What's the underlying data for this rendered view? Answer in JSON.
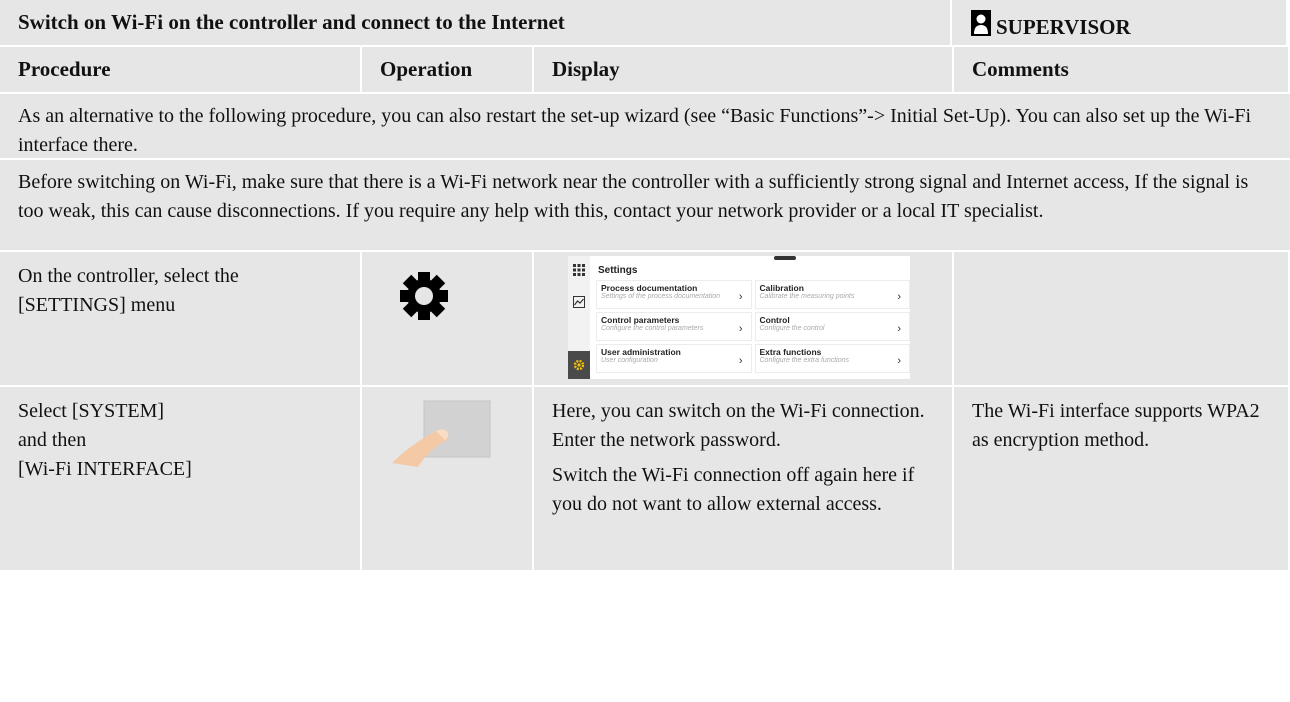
{
  "title": "Switch on Wi-Fi on the controller and connect to the Internet",
  "role": {
    "label": "SUPERVISOR",
    "icon": "user-icon"
  },
  "columns": [
    "Procedure",
    "Operation",
    "Display",
    "Comments"
  ],
  "notes": [
    "As an alternative to the following procedure, you can also restart the set-up wizard (see “Basic Functions”-> Initial Set-Up). You can also set up the Wi-Fi interface there.",
    "Before switching on Wi-Fi, make sure that there is a Wi-Fi network near the controller with a sufficiently strong signal and Internet access, If the signal is too weak, this can cause disconnections. If you require any help with this, contact your network provider or a local IT specialist."
  ],
  "steps": [
    {
      "procedure": "On the controller, select the [SETTINGS] menu",
      "operation_icon": "gear-icon",
      "display_mock": {
        "title": "Settings",
        "tiles": [
          {
            "heading": "Process documentation",
            "sub": "Settings of the process documentation"
          },
          {
            "heading": "Calibration",
            "sub": "Calibrate the measuring points"
          },
          {
            "heading": "Control parameters",
            "sub": "Configure the control parameters"
          },
          {
            "heading": "Control",
            "sub": "Configure the control"
          },
          {
            "heading": "User administration",
            "sub": "User configuration"
          },
          {
            "heading": "Extra functions",
            "sub": "Configure the extra functions"
          }
        ],
        "accent": "#f2c200"
      },
      "comments": ""
    },
    {
      "procedure_lines": [
        "Select [SYSTEM]",
        "and then",
        "[Wi-Fi INTERFACE]"
      ],
      "operation_icon": "finger-tap-icon",
      "display_paragraphs": [
        "Here, you can switch on the Wi-Fi connection. Enter the network password.",
        "Switch the Wi-Fi connection off again here if you do not want to allow external access."
      ],
      "comments": "The Wi-Fi interface supports WPA2 as encryption method."
    }
  ],
  "colors": {
    "cell_bg": "#e6e6e6",
    "accent": "#f2c200"
  }
}
